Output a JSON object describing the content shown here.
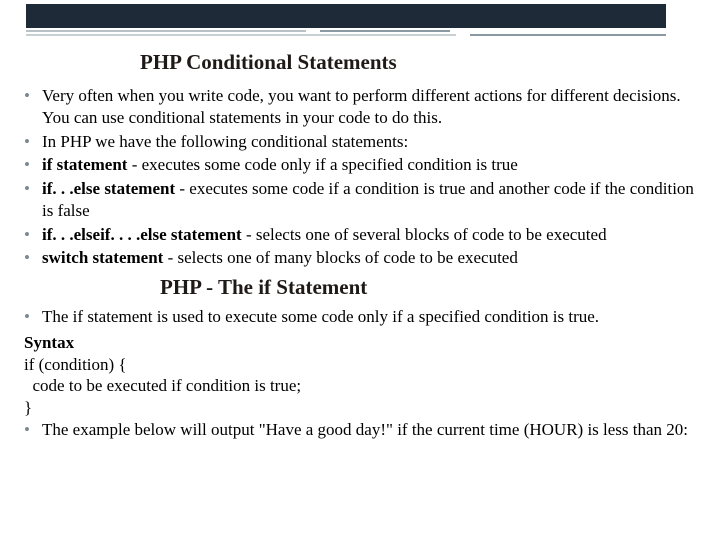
{
  "heading1": "PHP Conditional Statements",
  "list1": {
    "i0": "Very often when you write code, you want to perform different actions for different decisions. You can use conditional statements in your code to do this.",
    "i1": "In PHP we have the following conditional statements:",
    "i2_b": "if statement",
    "i2_r": " - executes some code only if a specified condition is true",
    "i3_b": "if. . .else statement",
    "i3_r": " - executes some code if a condition is true and another code if the condition is false",
    "i4_b": "if. . .elseif. . . .else statement",
    "i4_r": " - selects one of several blocks of code to be executed",
    "i5_b": "switch statement",
    "i5_r": " - selects one of many blocks of code to be executed"
  },
  "heading2": "PHP - The if Statement",
  "list2": {
    "i0": "The if statement is used to execute some code only if a specified condition is true."
  },
  "syntax": {
    "label": "Syntax",
    "line1": "if (condition) {",
    "line2": "  code to be executed if condition is true;",
    "line3": "}"
  },
  "list3": {
    "i0": "The example below will output \"Have a good day!\" if the current time (HOUR) is less than 20:"
  }
}
